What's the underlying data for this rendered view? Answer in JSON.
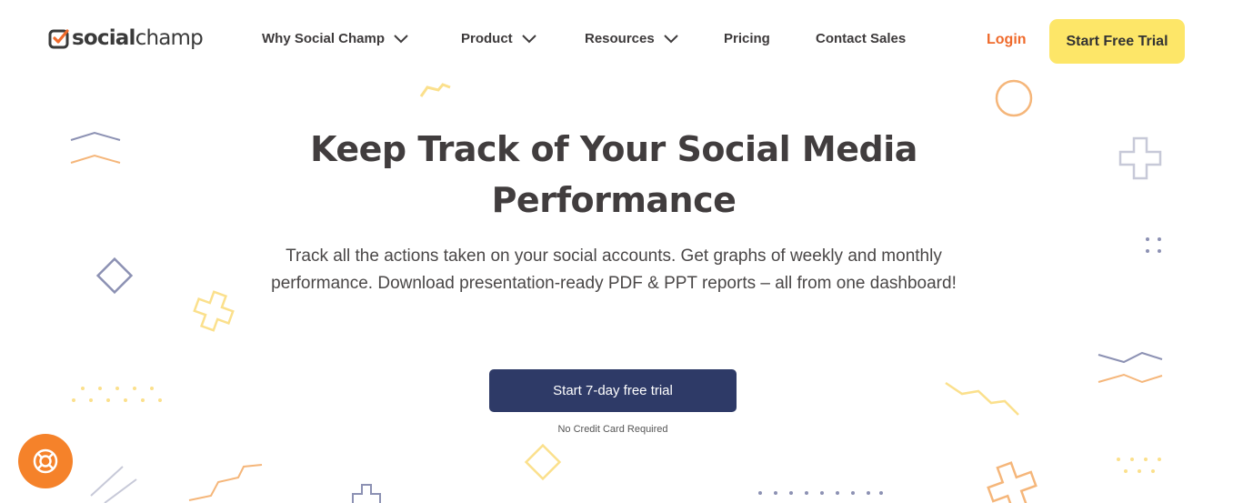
{
  "brand": {
    "name_bold": "social",
    "name_light": "champ",
    "icon": "check-badge-icon"
  },
  "nav": {
    "items": [
      {
        "label": "Why Social Champ",
        "dropdown": true
      },
      {
        "label": "Product",
        "dropdown": true
      },
      {
        "label": "Resources",
        "dropdown": true
      },
      {
        "label": "Pricing",
        "dropdown": false
      },
      {
        "label": "Contact Sales",
        "dropdown": false
      }
    ],
    "login": "Login",
    "cta": "Start Free Trial"
  },
  "hero": {
    "title_line1": "Keep Track of Your Social Media",
    "title_line2": "Performance",
    "description": "Track all the actions taken on your social accounts. Get graphs of weekly and monthly performance. Download presentation-ready PDF & PPT reports – all from one dashboard!",
    "cta": "Start 7-day free trial",
    "note": "No Credit Card Required"
  },
  "help_widget": {
    "icon": "lifebuoy-icon"
  },
  "colors": {
    "accent_orange": "#ef6a2b",
    "cta_yellow": "#fde668",
    "cta_navy": "#2e3a67",
    "deco_slate": "#8c91b3",
    "deco_orange": "#f5b67a",
    "deco_yellow": "#fbe08c"
  }
}
